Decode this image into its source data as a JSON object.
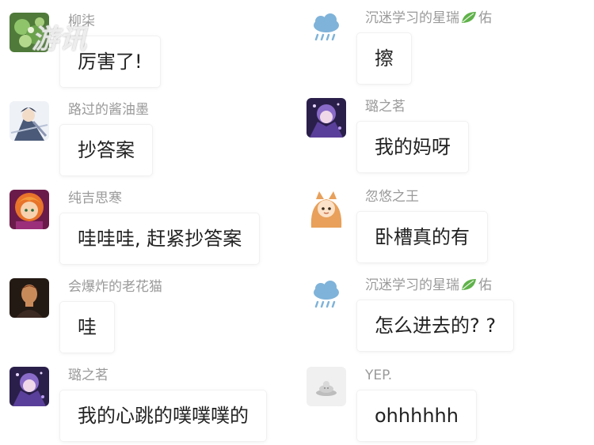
{
  "watermark": "游讯",
  "left_column": [
    {
      "name": "柳柒",
      "text": "厉害了!",
      "avatar": "green-flower-avatar"
    },
    {
      "name": "路过的酱油墨",
      "text": "抄答案",
      "avatar": "anime-swordsman-avatar"
    },
    {
      "name": "纯吉思寒",
      "text": "哇哇哇, 赶紧抄答案",
      "avatar": "orange-hair-girl-avatar"
    },
    {
      "name": "会爆炸的老花猫",
      "text": "哇",
      "avatar": "dark-portrait-avatar"
    },
    {
      "name": "璐之茗",
      "text": "我的心跳的噗噗噗的",
      "avatar": "purple-anime-avatar"
    }
  ],
  "right_column": [
    {
      "name_prefix": "沉迷学习的星瑞",
      "name_suffix": "佑",
      "name_icon": "leaf-icon",
      "text": "擦",
      "avatar": "rain-cloud-avatar"
    },
    {
      "name": "璐之茗",
      "text": "我的妈呀",
      "avatar": "purple-anime-avatar"
    },
    {
      "name": "忽悠之王",
      "text": "卧槽真的有",
      "avatar": "fox-girl-avatar"
    },
    {
      "name_prefix": "沉迷学习的星瑞",
      "name_suffix": "佑",
      "name_icon": "leaf-icon",
      "text": "怎么进去的? ?",
      "avatar": "rain-cloud-avatar"
    },
    {
      "name": "YEP.",
      "text": "ohhhhhh",
      "avatar": "default-gray-avatar"
    }
  ],
  "colors": {
    "name": "#9a9a9a",
    "message": "#222222",
    "bubble": "#ffffff",
    "leaf": "#5fb24a"
  }
}
